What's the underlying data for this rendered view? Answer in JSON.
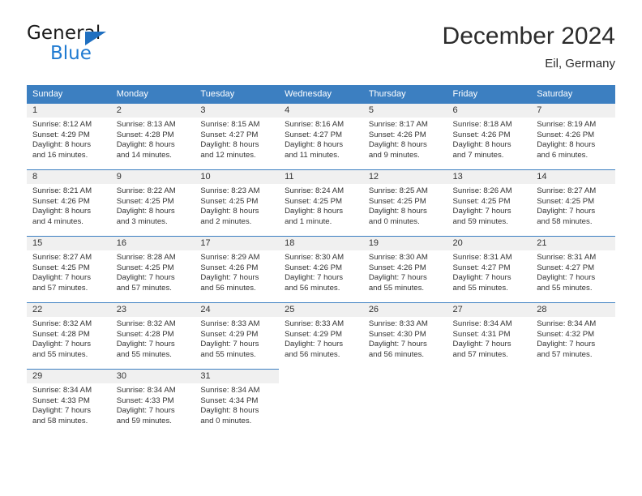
{
  "brand": {
    "name_part1": "General",
    "name_part2": "Blue",
    "triangle_color": "#1f6fc0",
    "blue_color": "#1f7ad1"
  },
  "header": {
    "title": "December 2024",
    "subtitle": "Eil, Germany",
    "accent_color": "#3c7fc1",
    "shade_color": "#f0f0f0"
  },
  "calendar": {
    "weekday_headers": [
      "Sunday",
      "Monday",
      "Tuesday",
      "Wednesday",
      "Thursday",
      "Friday",
      "Saturday"
    ],
    "weeks": [
      [
        {
          "day": "1",
          "sunrise": "Sunrise: 8:12 AM",
          "sunset": "Sunset: 4:29 PM",
          "daylight_line1": "Daylight: 8 hours",
          "daylight_line2": "and 16 minutes."
        },
        {
          "day": "2",
          "sunrise": "Sunrise: 8:13 AM",
          "sunset": "Sunset: 4:28 PM",
          "daylight_line1": "Daylight: 8 hours",
          "daylight_line2": "and 14 minutes."
        },
        {
          "day": "3",
          "sunrise": "Sunrise: 8:15 AM",
          "sunset": "Sunset: 4:27 PM",
          "daylight_line1": "Daylight: 8 hours",
          "daylight_line2": "and 12 minutes."
        },
        {
          "day": "4",
          "sunrise": "Sunrise: 8:16 AM",
          "sunset": "Sunset: 4:27 PM",
          "daylight_line1": "Daylight: 8 hours",
          "daylight_line2": "and 11 minutes."
        },
        {
          "day": "5",
          "sunrise": "Sunrise: 8:17 AM",
          "sunset": "Sunset: 4:26 PM",
          "daylight_line1": "Daylight: 8 hours",
          "daylight_line2": "and 9 minutes."
        },
        {
          "day": "6",
          "sunrise": "Sunrise: 8:18 AM",
          "sunset": "Sunset: 4:26 PM",
          "daylight_line1": "Daylight: 8 hours",
          "daylight_line2": "and 7 minutes."
        },
        {
          "day": "7",
          "sunrise": "Sunrise: 8:19 AM",
          "sunset": "Sunset: 4:26 PM",
          "daylight_line1": "Daylight: 8 hours",
          "daylight_line2": "and 6 minutes."
        }
      ],
      [
        {
          "day": "8",
          "sunrise": "Sunrise: 8:21 AM",
          "sunset": "Sunset: 4:26 PM",
          "daylight_line1": "Daylight: 8 hours",
          "daylight_line2": "and 4 minutes."
        },
        {
          "day": "9",
          "sunrise": "Sunrise: 8:22 AM",
          "sunset": "Sunset: 4:25 PM",
          "daylight_line1": "Daylight: 8 hours",
          "daylight_line2": "and 3 minutes."
        },
        {
          "day": "10",
          "sunrise": "Sunrise: 8:23 AM",
          "sunset": "Sunset: 4:25 PM",
          "daylight_line1": "Daylight: 8 hours",
          "daylight_line2": "and 2 minutes."
        },
        {
          "day": "11",
          "sunrise": "Sunrise: 8:24 AM",
          "sunset": "Sunset: 4:25 PM",
          "daylight_line1": "Daylight: 8 hours",
          "daylight_line2": "and 1 minute."
        },
        {
          "day": "12",
          "sunrise": "Sunrise: 8:25 AM",
          "sunset": "Sunset: 4:25 PM",
          "daylight_line1": "Daylight: 8 hours",
          "daylight_line2": "and 0 minutes."
        },
        {
          "day": "13",
          "sunrise": "Sunrise: 8:26 AM",
          "sunset": "Sunset: 4:25 PM",
          "daylight_line1": "Daylight: 7 hours",
          "daylight_line2": "and 59 minutes."
        },
        {
          "day": "14",
          "sunrise": "Sunrise: 8:27 AM",
          "sunset": "Sunset: 4:25 PM",
          "daylight_line1": "Daylight: 7 hours",
          "daylight_line2": "and 58 minutes."
        }
      ],
      [
        {
          "day": "15",
          "sunrise": "Sunrise: 8:27 AM",
          "sunset": "Sunset: 4:25 PM",
          "daylight_line1": "Daylight: 7 hours",
          "daylight_line2": "and 57 minutes."
        },
        {
          "day": "16",
          "sunrise": "Sunrise: 8:28 AM",
          "sunset": "Sunset: 4:25 PM",
          "daylight_line1": "Daylight: 7 hours",
          "daylight_line2": "and 57 minutes."
        },
        {
          "day": "17",
          "sunrise": "Sunrise: 8:29 AM",
          "sunset": "Sunset: 4:26 PM",
          "daylight_line1": "Daylight: 7 hours",
          "daylight_line2": "and 56 minutes."
        },
        {
          "day": "18",
          "sunrise": "Sunrise: 8:30 AM",
          "sunset": "Sunset: 4:26 PM",
          "daylight_line1": "Daylight: 7 hours",
          "daylight_line2": "and 56 minutes."
        },
        {
          "day": "19",
          "sunrise": "Sunrise: 8:30 AM",
          "sunset": "Sunset: 4:26 PM",
          "daylight_line1": "Daylight: 7 hours",
          "daylight_line2": "and 55 minutes."
        },
        {
          "day": "20",
          "sunrise": "Sunrise: 8:31 AM",
          "sunset": "Sunset: 4:27 PM",
          "daylight_line1": "Daylight: 7 hours",
          "daylight_line2": "and 55 minutes."
        },
        {
          "day": "21",
          "sunrise": "Sunrise: 8:31 AM",
          "sunset": "Sunset: 4:27 PM",
          "daylight_line1": "Daylight: 7 hours",
          "daylight_line2": "and 55 minutes."
        }
      ],
      [
        {
          "day": "22",
          "sunrise": "Sunrise: 8:32 AM",
          "sunset": "Sunset: 4:28 PM",
          "daylight_line1": "Daylight: 7 hours",
          "daylight_line2": "and 55 minutes."
        },
        {
          "day": "23",
          "sunrise": "Sunrise: 8:32 AM",
          "sunset": "Sunset: 4:28 PM",
          "daylight_line1": "Daylight: 7 hours",
          "daylight_line2": "and 55 minutes."
        },
        {
          "day": "24",
          "sunrise": "Sunrise: 8:33 AM",
          "sunset": "Sunset: 4:29 PM",
          "daylight_line1": "Daylight: 7 hours",
          "daylight_line2": "and 55 minutes."
        },
        {
          "day": "25",
          "sunrise": "Sunrise: 8:33 AM",
          "sunset": "Sunset: 4:29 PM",
          "daylight_line1": "Daylight: 7 hours",
          "daylight_line2": "and 56 minutes."
        },
        {
          "day": "26",
          "sunrise": "Sunrise: 8:33 AM",
          "sunset": "Sunset: 4:30 PM",
          "daylight_line1": "Daylight: 7 hours",
          "daylight_line2": "and 56 minutes."
        },
        {
          "day": "27",
          "sunrise": "Sunrise: 8:34 AM",
          "sunset": "Sunset: 4:31 PM",
          "daylight_line1": "Daylight: 7 hours",
          "daylight_line2": "and 57 minutes."
        },
        {
          "day": "28",
          "sunrise": "Sunrise: 8:34 AM",
          "sunset": "Sunset: 4:32 PM",
          "daylight_line1": "Daylight: 7 hours",
          "daylight_line2": "and 57 minutes."
        }
      ],
      [
        {
          "day": "29",
          "sunrise": "Sunrise: 8:34 AM",
          "sunset": "Sunset: 4:33 PM",
          "daylight_line1": "Daylight: 7 hours",
          "daylight_line2": "and 58 minutes."
        },
        {
          "day": "30",
          "sunrise": "Sunrise: 8:34 AM",
          "sunset": "Sunset: 4:33 PM",
          "daylight_line1": "Daylight: 7 hours",
          "daylight_line2": "and 59 minutes."
        },
        {
          "day": "31",
          "sunrise": "Sunrise: 8:34 AM",
          "sunset": "Sunset: 4:34 PM",
          "daylight_line1": "Daylight: 8 hours",
          "daylight_line2": "and 0 minutes."
        },
        {
          "day": "",
          "sunrise": "",
          "sunset": "",
          "daylight_line1": "",
          "daylight_line2": ""
        },
        {
          "day": "",
          "sunrise": "",
          "sunset": "",
          "daylight_line1": "",
          "daylight_line2": ""
        },
        {
          "day": "",
          "sunrise": "",
          "sunset": "",
          "daylight_line1": "",
          "daylight_line2": ""
        },
        {
          "day": "",
          "sunrise": "",
          "sunset": "",
          "daylight_line1": "",
          "daylight_line2": ""
        }
      ]
    ]
  }
}
